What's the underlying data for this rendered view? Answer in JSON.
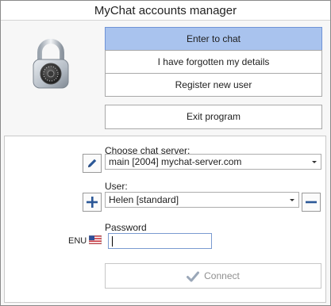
{
  "window": {
    "title": "MyChat accounts manager"
  },
  "actions": {
    "enter_chat": "Enter to chat",
    "forgot_details": "I have forgotten my details",
    "register": "Register new user",
    "exit": "Exit program"
  },
  "server": {
    "label": "Choose chat server:",
    "selected": "main [2004] mychat-server.com"
  },
  "user": {
    "label": "User:",
    "selected": "Helen [standard]"
  },
  "password": {
    "label": "Password",
    "value": "",
    "keyboard_layout": "ENU"
  },
  "connect": {
    "label": "Connect",
    "enabled": false
  },
  "icons": {
    "lock": "padlock-icon",
    "edit_server": "pencil-icon",
    "add_user": "plus-icon",
    "remove_user": "minus-icon",
    "flag": "us-flag-icon",
    "connect": "checkmark-icon"
  },
  "colors": {
    "primary_button": "#a9c3ee",
    "icon_blue": "#2b5797"
  }
}
